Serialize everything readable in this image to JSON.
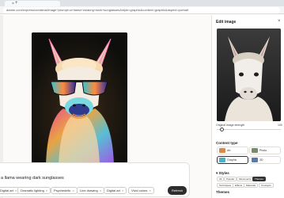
{
  "browser": {
    "tab_close": "×",
    "new_tab": "+",
    "url": "adobe.com/express/create/ai/image?prompt=a+llama+wearing+dark+sunglasses&style=graphic&content=graphic&aspect=portrait"
  },
  "prompt": {
    "text": "a llama wearing dark sunglasses",
    "chips": [
      {
        "label": "Digital art",
        "close": "×"
      },
      {
        "label": "Dramatic lighting",
        "close": "×"
      },
      {
        "label": "Psychedelic",
        "close": "×"
      },
      {
        "label": "Line drawing",
        "close": "×"
      },
      {
        "label": "Digital art",
        "close": "×"
      },
      {
        "label": "Vivid colors",
        "close": "×"
      }
    ],
    "refresh_label": "Refresh"
  },
  "panel": {
    "title": "Edit image",
    "close": "×",
    "original_label": "Original image strength",
    "original_value": "100",
    "original_fraction": 0.08,
    "content_type_title": "Content type",
    "content_types": [
      {
        "label": "Art",
        "selected": false,
        "color": "#d98a4a"
      },
      {
        "label": "Photo",
        "selected": false,
        "color": "#7a8a6a"
      },
      {
        "label": "Graphic",
        "selected": true,
        "color": "#4fb0c8"
      },
      {
        "label": "3D",
        "selected": false,
        "color": "#5a7aa8"
      }
    ],
    "styles_title": "Styles",
    "style_rows": [
      [
        {
          "label": "All",
          "selected": false
        },
        {
          "label": "Popular",
          "selected": false
        },
        {
          "label": "Movements",
          "selected": false
        },
        {
          "label": "Themes",
          "selected": true
        }
      ],
      [
        {
          "label": "Techniques",
          "selected": false
        },
        {
          "label": "Effects",
          "selected": false
        },
        {
          "label": "Materials",
          "selected": false
        },
        {
          "label": "Concepts",
          "selected": false
        }
      ]
    ],
    "themes_title": "Themes"
  }
}
